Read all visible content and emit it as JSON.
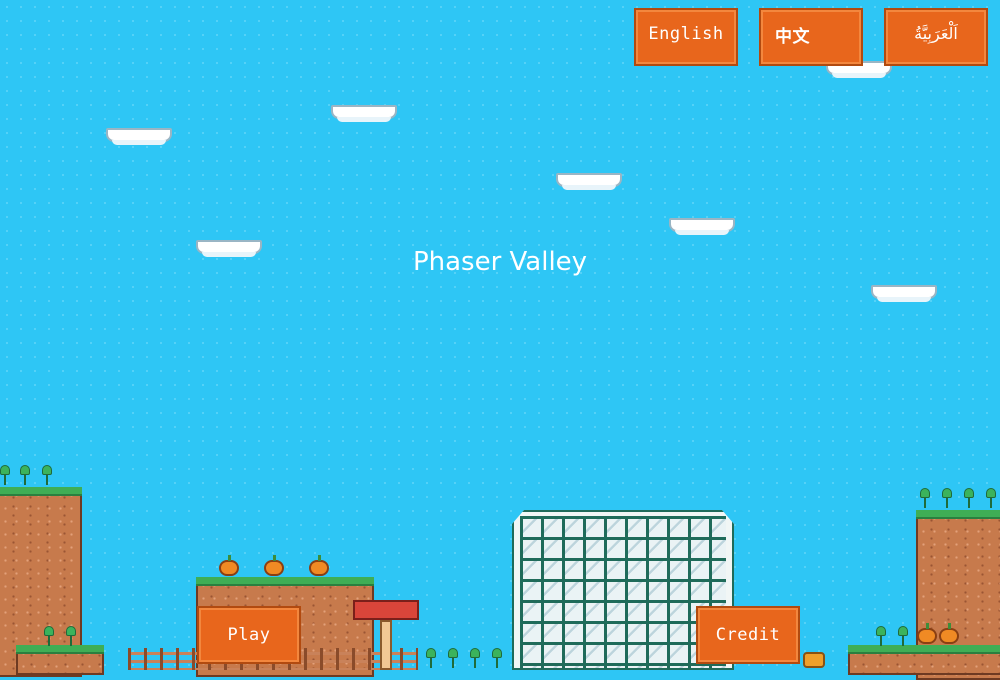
{
  "game": {
    "title": "Phaser Valley"
  },
  "language_menu": {
    "english_label": "English",
    "chinese_label": "中文",
    "arabic_label": "اَلْعَرَبِيَّةُ"
  },
  "main_menu": {
    "play_label": "Play",
    "credit_label": "Credit"
  },
  "colors": {
    "sky": "#2ec6f5",
    "button": "#e8661c",
    "button_border": "#b24a0f",
    "grass": "#3fae55",
    "dirt": "#c77a4c"
  },
  "icons": [
    "cloud-platform",
    "pumpkin",
    "plant",
    "mushroom-sign",
    "greenhouse",
    "fence",
    "barrel"
  ]
}
